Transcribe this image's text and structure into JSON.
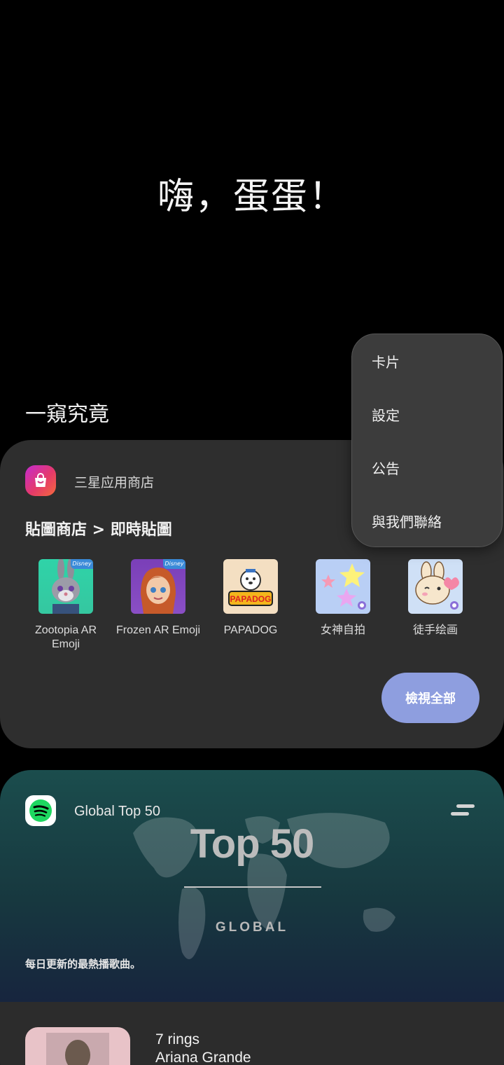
{
  "greeting": "嗨，蛋蛋！",
  "section_title": "一窺究竟",
  "store_card": {
    "store_name": "三星应用商店",
    "subtitle": "貼圖商店 > 即時貼圖",
    "view_all": "檢視全部",
    "apps": [
      {
        "label": "Zootopia AR Emoji",
        "badge": "Disney"
      },
      {
        "label": "Frozen AR Emoji",
        "badge": "Disney"
      },
      {
        "label": "PAPADOG",
        "icon_text": "PAPADOG"
      },
      {
        "label": "女神自拍"
      },
      {
        "label": "徒手绘画"
      }
    ]
  },
  "spotify_card": {
    "playlist_name": "Global Top 50",
    "cover_title": "Top 50",
    "cover_subtitle": "GLOBAL",
    "description": "每日更新的最熱播歌曲。",
    "track": {
      "title": "7 rings",
      "artist": "Ariana Grande"
    }
  },
  "menu": {
    "items": [
      "卡片",
      "設定",
      "公告",
      "與我們聯絡"
    ]
  },
  "colors": {
    "background": "#000000",
    "card": "#2e2e2e",
    "view_all_button": "#8e9edf",
    "spotify_green": "#1ed760",
    "menu": "#3c3c3c"
  }
}
